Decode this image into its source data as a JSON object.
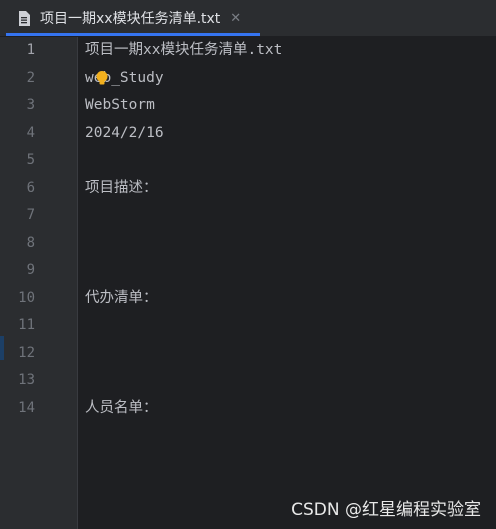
{
  "tab": {
    "title": "项目一期xx模块任务清单.txt",
    "close_glyph": "✕",
    "icon": "text-file-icon"
  },
  "editor": {
    "line_numbers": [
      "1",
      "2",
      "3",
      "4",
      "5",
      "6",
      "7",
      "8",
      "9",
      "10",
      "11",
      "12",
      "13",
      "14"
    ],
    "lines": [
      "项目一期xx模块任务清单.txt",
      "web_Study",
      "WebStorm",
      "2024/2/16",
      "",
      "项目描述：",
      "",
      "",
      "",
      "代办清单：",
      "",
      "",
      "",
      "人员名单："
    ],
    "intention_icon": "lightbulb-icon"
  },
  "watermark": "CSDN @红星编程实验室",
  "colors": {
    "accent": "#3574f0",
    "editor_bg": "#1e1f22",
    "gutter_bg": "#2b2d30",
    "text": "#bcbec4",
    "line_number": "#6f737a",
    "bulb": "#f2b01e"
  }
}
